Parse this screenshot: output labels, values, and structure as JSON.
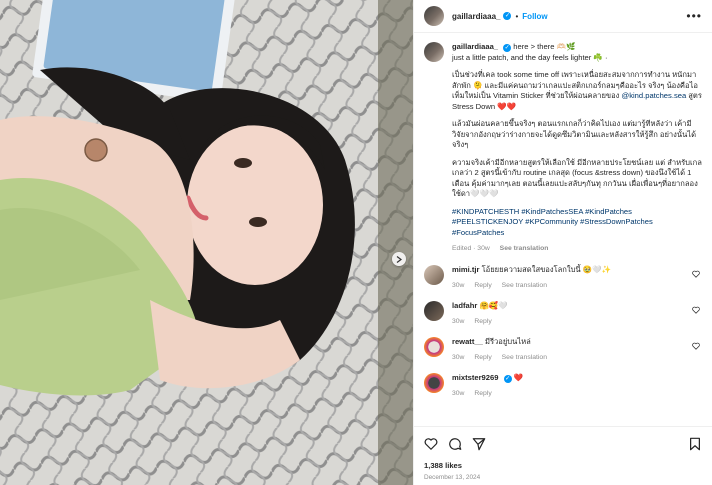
{
  "post": {
    "username": "gaillardiaaa_",
    "follow_label": "Follow",
    "more_label": "•••",
    "caption_lines": [
      "here > there 🫶🏻🌿",
      "just a little patch, and the day feels lighter ☘️ ·"
    ],
    "paragraph1_before_link": "เป็นช่วงที่เคล took some time off เพราะเหนื่อยสะสมจากการทำงาน หนักมาสักพัก 🫠 และมีแค่คนถามว่าเกลแปะสติกเกอร์กลมๆคืออะไร จริงๆ น้องคือไอเท็มใหม่เป็น Vitamin Sticker ที่ช่วยให้ผ่อนคลายของ",
    "paragraph1_link": "@kind.patches.sea",
    "paragraph1_after_link": " สูตร Stress Down",
    "paragraph1_emoji": "❤️❤️",
    "paragraph2": "แล้วมันผ่อนคลายขึ้นจริงๆ ตอนแรกเกลก็ว่าคิดไปเอง แต่มารู้ทีหลังว่า เค้ามีวิจัยจากอังกฤษว่าร่างกายจะได้ดูดซึมวิตามินและหลังสารให้รู้สึก อย่างนั้นได้จริงๆ",
    "paragraph3": "ความจริงเค้ามีอีกหลายสูตรให้เลือกใช้ มีอีกหลายประโยชน์เลย แต่ สำหรับเกล เกลว่า 2 สูตรนี้เข้ากับ routine เกลสุด (focus &stress down) ของนึงใช้ได้ 1 เดือน คุ้มค่ามากๆเลย ตอนนี้เลยแปะสลับๆกันทุ กกวันน เผื่อเพื่อนๆที่อยากลองใช้ดา🤍🤍🤍",
    "hashtags": "#KINDPATCHESTH #KindPatchesSEA #KindPatches #PEELSTICKENJOY #KPCommunity #StressDownPatches #FocusPatches",
    "edited_label": "Edited · 30w",
    "see_translation": "See translation",
    "likes": "1,388 likes",
    "date": "December 13, 2024"
  },
  "comments": [
    {
      "user": "mimi.tjr",
      "text": "โอ้ยยยความสดใสของโลกใบนี้ 🥹🤍✨",
      "age": "30w",
      "reply": "Reply",
      "see_translation": "See translation"
    },
    {
      "user": "ladfahr",
      "text": "🤗🥰🤍",
      "age": "30w",
      "reply": "Reply",
      "see_translation": ""
    },
    {
      "user": "rewatt__",
      "text": "มีรีวอยู่บนไหล่",
      "age": "30w",
      "reply": "Reply",
      "see_translation": "See translation"
    },
    {
      "user": "mixtster9269",
      "text": "❤️",
      "age": "30w",
      "reply": "Reply",
      "see_translation": ""
    }
  ],
  "colors": {
    "accent": "#0095f6",
    "link": "#00376b",
    "muted": "#8e8e8e",
    "heart": "#e8473d"
  }
}
